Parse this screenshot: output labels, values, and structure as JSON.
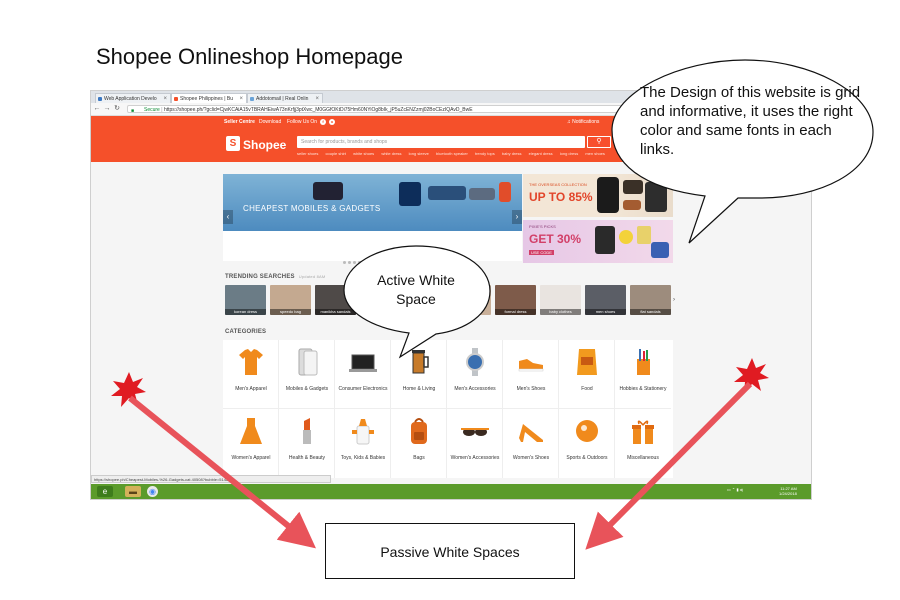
{
  "slide": {
    "title": "Shopee Onlineshop Homepage"
  },
  "browser": {
    "tabs": [
      {
        "label": "Web Application Develo",
        "active": false
      },
      {
        "label": "Shopee Philippines | Bu",
        "active": true
      },
      {
        "label": "Addotomail | Real Onlin",
        "active": false
      }
    ],
    "url_prefix": "Secure",
    "url": "https://shopee.ph/?gclid=CjwKCAiA15vTBRAHEiwA73nKrfjj3ptXwc_M0GGfOKtDi75Hm60NYiOg8bIk_jP5uZcENZzmj02BoCEzIQAvD_BwE"
  },
  "shopee": {
    "top_links": [
      "Seller Centre",
      "Download",
      "Follow Us On"
    ],
    "notifications": "Notifications",
    "logo": "Shopee",
    "search_placeholder": "Search for products, brands and shops",
    "trending_words": [
      "seller shoes",
      "couple shirt",
      "white shoes",
      "white dress",
      "long sleeve",
      "bluetooth speaker",
      "trendy tops",
      "baby dress",
      "elegant dress",
      "long dress",
      "men shoes"
    ]
  },
  "banners": {
    "main_text": "CHEAPEST MOBILES & GADGETS",
    "promo1_small": "THE OVERSEAS COLLECTION",
    "promo1_big": "UP TO 85%",
    "promo2_small": "PIXIE'S PICKS",
    "promo2_big": "GET 30%",
    "promo2_code": "USE CODE"
  },
  "trending": {
    "heading": "TRENDING SEARCHES",
    "updated": "Updated 8AM",
    "items": [
      "korean dress",
      "speedo bag",
      "manikha sandals",
      "",
      "",
      "",
      "formal dress",
      "baby clothes",
      "men shoes",
      "flat sandals"
    ]
  },
  "categories": {
    "heading": "CATEGORIES",
    "items": [
      "Men's Apparel",
      "Mobiles & Gadgets",
      "Consumer Electronics",
      "Home & Living",
      "Men's Accessories",
      "Men's Shoes",
      "Food",
      "Hobbies & Stationery",
      "Women's Apparel",
      "Health & Beauty",
      "Toys, Kids & Babies",
      "Bags",
      "Women's Accessories",
      "Women's Shoes",
      "Sports & Outdoors",
      "Miscellaneous"
    ]
  },
  "statusbar": {
    "url": "https://shopee.ph/Cheapest-Mobiles-%26-Gadgets-cat.40508?bubble=5148"
  },
  "taskbar": {
    "time": "11:27 AM",
    "date": "1/24/2018"
  },
  "annotations": {
    "design_note": "The Design of this website is grid and informative, it uses the right color and same fonts in each links.",
    "active_label": "Active White Space",
    "passive_label": "Passive White Spaces"
  },
  "colors": {
    "shopee_orange": "#f5502a",
    "arrow_red": "#e8535a",
    "starburst_red": "#e01b22",
    "taskbar_green": "#5b9b2b"
  }
}
